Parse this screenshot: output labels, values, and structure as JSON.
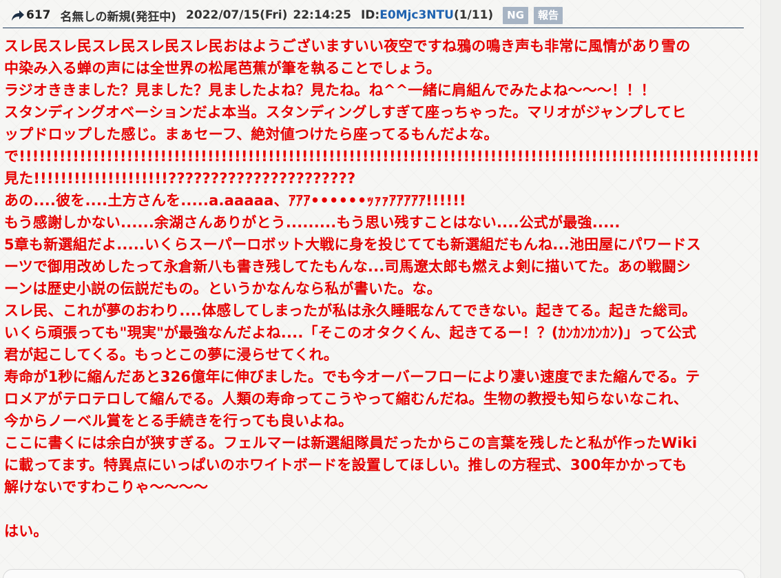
{
  "header": {
    "res_count": "617",
    "name": "名無しの新規(発狂中)",
    "date": "2022/07/15(Fri)",
    "time": "22:14:25",
    "id_label": "ID:",
    "id_value": "E0Mjc3NTU",
    "id_count": "(1/11)",
    "ng_label": "NG",
    "report_label": "報告"
  },
  "body": {
    "lines": [
      "スレ民スレ民スレ民スレ民スレ民おはようございますいい夜空ですね鴉の鳴き声も非常に風情があり雪の",
      "中染み入る蝉の声には全世界の松尾芭蕉が筆を執ることでしょう。",
      "ラジオききました？見ました？見ましたよね？見たね。ね^^一緒に肩組んでみたよね～～～！！！",
      "スタンディングオベーションだよ本当。スタンディングしすぎて座っちゃった。マリオがジャンプしてヒ",
      "ップドロップした感じ。まぁセーフ、絶対値つけたら座ってるもんだよな。",
      "で!!!!!!!!!!!!!!!!!!!!!!!!!!!!!!!!!!!!!!!!!!!!!!!!!!!!!!!!!!!!!!!!!!!!!!!!!!!!!!!!!!!!!!!!!!!!!!!!!!!!!!!!!!!!!!!!",
      "見た!!!!!!!!!!!!!!!!!!!!??????????????????????",
      "あの....彼を....土方さんを.....a.aaaaa、ｱｱｱ••••••ｯｧｧｱｱｱｱｱ!!!!!!",
      "もう感謝しかない......余湖さんありがとう.........もう思い残すことはない....公式が最強.....",
      "5章も新選組だよ.....いくらスーパーロボット大戦に身を投じてても新選組だもんね...池田屋にパワードス",
      "ーツで御用改めしたって永倉新八も書き残してたもんな...司馬遼太郎も燃えよ剣に描いてた。あの戦闘シ",
      "ーンは歴史小説の伝説だもの。というかなんなら私が書いた。な。",
      "スレ民、これが夢のおわり....体感してしまったが私は永久睡眠なんてできない。起きてる。起きた総司。",
      "いくら頑張っても\"現実\"が最強なんだよね....「そこのオタクくん、起きてるー！？(ｶﾝｶﾝｶﾝｶﾝ)」って公式",
      "君が起こしてくる。もっとこの夢に浸らせてくれ。",
      "寿命が1秒に縮んだあと326億年に伸びました。でも今オーバーフローにより凄い速度でまた縮んでる。テ",
      "ロメアがテロテロして縮んでる。人類の寿命ってこうやって縮むんだね。生物の教授も知らないなこれ、",
      "今からノーベル賞をとる手続きを行っても良いよね。",
      "ここに書くには余白が狭すぎる。フェルマーは新選組隊員だったからこの言葉を残したと私が作ったWiki",
      "に載ってます。特異点にいっぱいのホワイトボードを設置してほしい。推しの方程式、300年かかっても",
      "解けないですわこりゃ～～～～",
      "",
      "はい。"
    ]
  },
  "colors": {
    "body_text": "#e60000",
    "id_link": "#1f63b0",
    "badge_bg": "#a7b4c4",
    "header_rule": "#1d3a5a"
  },
  "icons": {
    "reply": "reply-arrow-icon"
  }
}
